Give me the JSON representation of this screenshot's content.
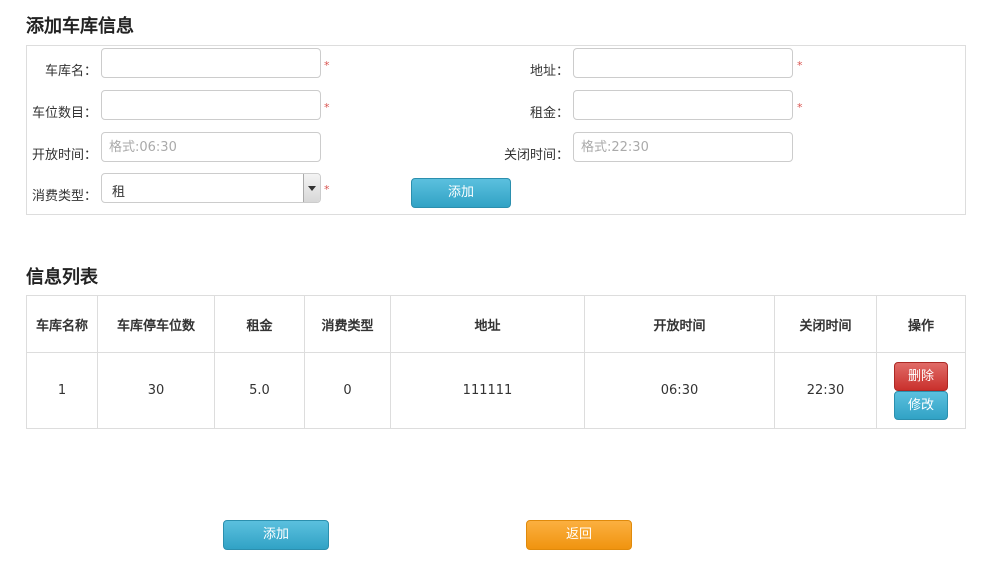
{
  "add_section": {
    "title": "添加车库信息",
    "fields": {
      "garage_name": {
        "label": "车库名：",
        "value": "",
        "required": "*"
      },
      "address": {
        "label": "地址：",
        "value": "",
        "required": "*"
      },
      "spaces": {
        "label": "车位数目：",
        "value": "",
        "required": "*"
      },
      "rent": {
        "label": "租金：",
        "value": "",
        "required": "*"
      },
      "open_time": {
        "label": "开放时间：",
        "placeholder": "格式:06:30"
      },
      "close_time": {
        "label": "关闭时间：",
        "placeholder": "格式:22:30"
      },
      "fee_type": {
        "label": "消费类型：",
        "selected": "租",
        "required": "*"
      }
    },
    "add_button": "添加"
  },
  "list_section": {
    "title": "信息列表",
    "headers": [
      "车库名称",
      "车库停车位数",
      "租金",
      "消费类型",
      "地址",
      "开放时间",
      "关闭时间",
      "操作"
    ],
    "rows": [
      {
        "name": "1",
        "spaces": "30",
        "rent": "5.0",
        "fee_type": "0",
        "address": "111111",
        "open": "06:30",
        "close": "22:30",
        "delete_label": "删除",
        "edit_label": "修改"
      }
    ]
  },
  "footer": {
    "add_button": "添加",
    "back_button": "返回"
  },
  "colors": {
    "info_button": "#31a2c5",
    "danger_button": "#c9302c",
    "warning_button": "#f0940f",
    "required_mark": "#d9534f"
  }
}
